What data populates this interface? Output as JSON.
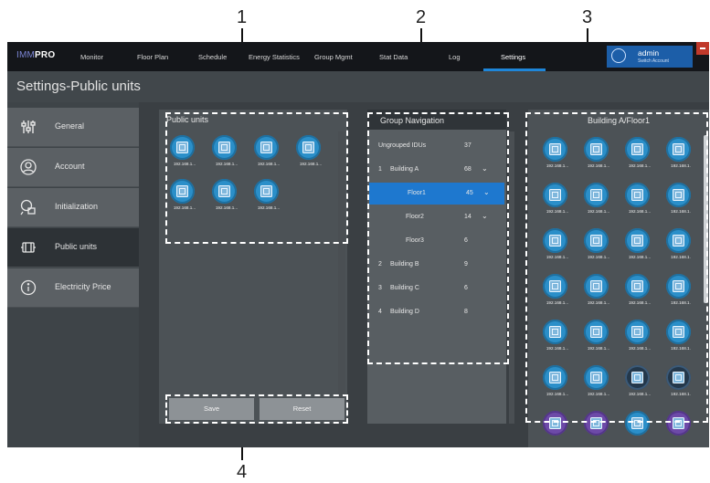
{
  "callouts": [
    "1",
    "2",
    "3",
    "4"
  ],
  "app": {
    "brand_prefix": "IMM",
    "brand_suffix": "PRO",
    "nav": [
      "Monitor",
      "Floor Plan",
      "Schedule",
      "Energy Statistics",
      "Group Mgmt",
      "Stat Data",
      "Log",
      "Settings"
    ],
    "active_nav": "Settings",
    "user": {
      "name": "admin",
      "switch": "Switch Account"
    },
    "page_title": "Settings-Public units",
    "accent": "#1e86d9"
  },
  "sidebar": {
    "items": [
      {
        "label": "General",
        "icon": "sliders-icon"
      },
      {
        "label": "Account",
        "icon": "user-icon"
      },
      {
        "label": "Initialization",
        "icon": "init-icon"
      },
      {
        "label": "Public units",
        "icon": "indoor-unit-icon"
      },
      {
        "label": "Electricity Price",
        "icon": "info-icon"
      }
    ],
    "active": "Public units"
  },
  "public_units": {
    "title": "Public units",
    "units": [
      "192.168.1...",
      "192.168.1...",
      "192.168.1...",
      "192.168.1...",
      "192.168.1...",
      "192.168.1...",
      "192.168.1..."
    ],
    "save_label": "Save",
    "reset_label": "Reset"
  },
  "group_nav": {
    "title": "Group Navigation",
    "rows": [
      {
        "num": "",
        "name": "Ungrouped IDUs",
        "count": "37",
        "chevron": false
      },
      {
        "num": "1",
        "name": "Building A",
        "count": "68",
        "chevron": true
      },
      {
        "num": "",
        "name": "Floor1",
        "count": "45",
        "chevron": true,
        "selected": true
      },
      {
        "num": "",
        "name": "Floor2",
        "count": "14",
        "chevron": true
      },
      {
        "num": "",
        "name": "Floor3",
        "count": "6",
        "chevron": false
      },
      {
        "num": "2",
        "name": "Building B",
        "count": "9",
        "chevron": false
      },
      {
        "num": "3",
        "name": "Building C",
        "count": "6",
        "chevron": false
      },
      {
        "num": "4",
        "name": "Building D",
        "count": "8",
        "chevron": false
      }
    ]
  },
  "floor_units": {
    "title": "Building A/Floor1",
    "ip": "192.168.1...",
    "ip_alt": "192.168.1.",
    "states": [
      "blue",
      "blue",
      "blue",
      "blue",
      "blue",
      "blue",
      "blue",
      "blue",
      "blue",
      "blue",
      "blue",
      "blue",
      "blue",
      "blue",
      "blue",
      "blue",
      "blue",
      "blue",
      "blue",
      "blue",
      "blue",
      "blue",
      "dark",
      "dark",
      "purple",
      "purple",
      "blue",
      "purple"
    ]
  }
}
